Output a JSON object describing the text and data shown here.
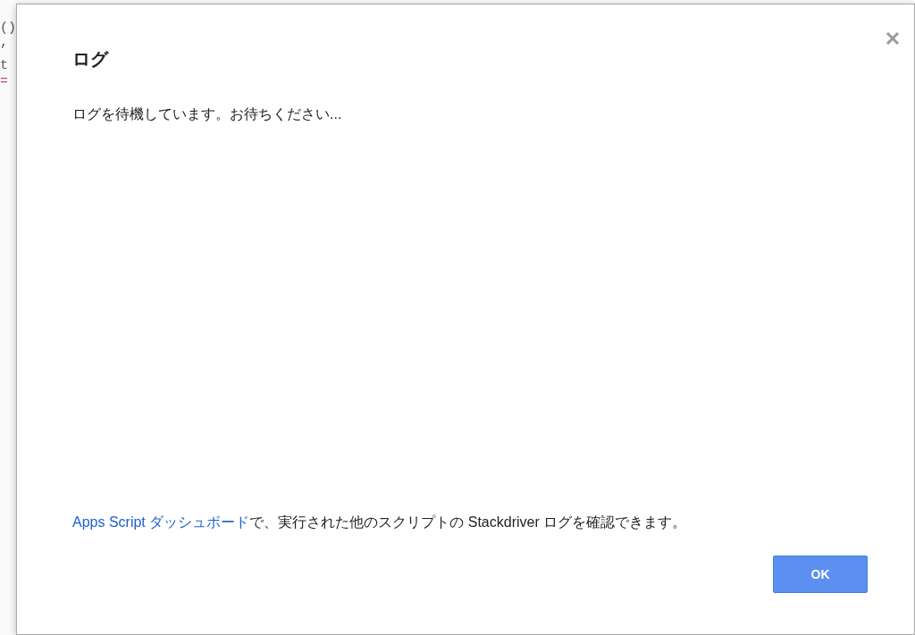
{
  "background_code": [
    {
      "text": "()",
      "kind": "plain"
    },
    {
      "text": ",",
      "kind": "plain"
    },
    {
      "text": "t",
      "kind": "plain"
    },
    {
      "text": "=",
      "kind": "operator"
    }
  ],
  "dialog": {
    "title": "ログ",
    "message": "ログを待機しています。お待ちください...",
    "footer": {
      "link": "Apps Script ダッシュボード",
      "text": "で、実行された他のスクリプトの Stackdriver ログを確認できます。"
    },
    "buttons": [
      "OK"
    ]
  }
}
